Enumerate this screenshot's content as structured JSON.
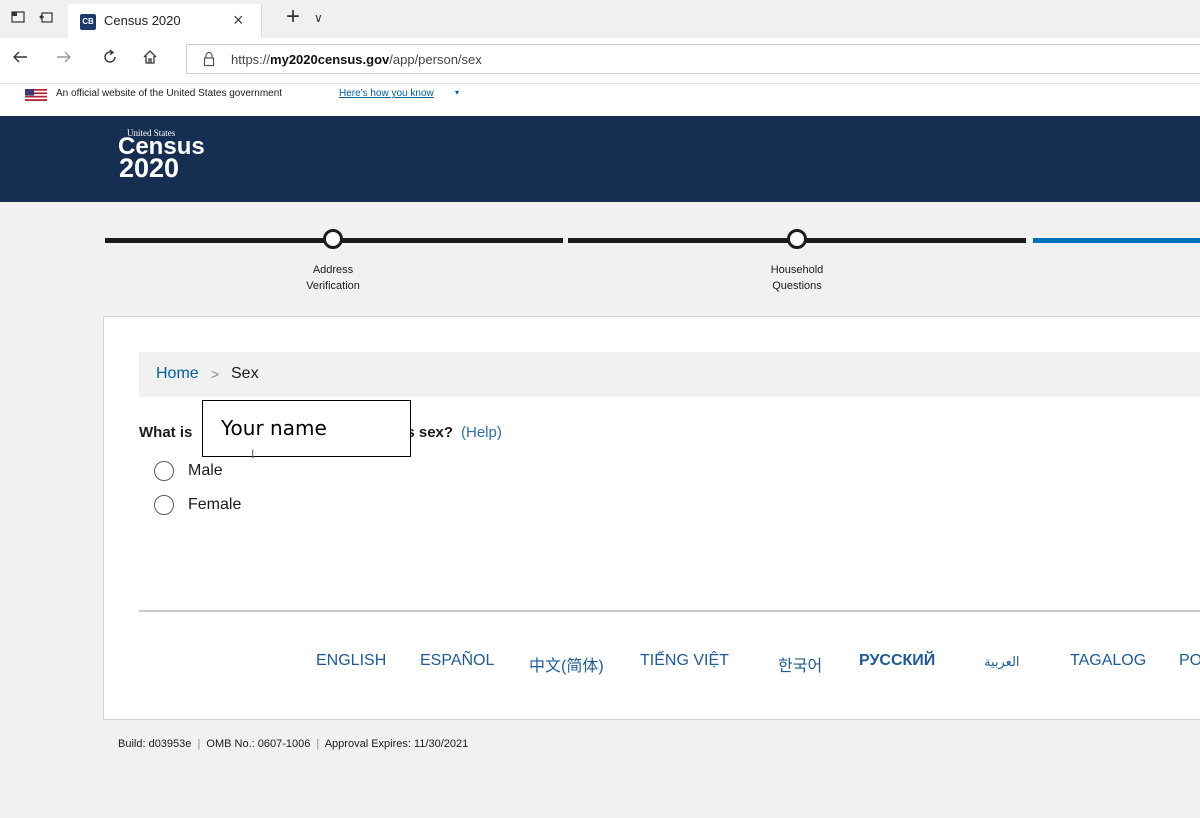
{
  "browser": {
    "tab_title": "Census 2020",
    "tab_favicon": "CB",
    "tab_close_glyph": "×",
    "new_tab_glyph": "+",
    "tab_dropdown_glyph": "∨",
    "url_prefix": "https://",
    "url_domain": "my2020census.gov",
    "url_path": "/app/person/sex",
    "icons": [
      "tab-manager-icon",
      "tab-aside-icon",
      "back-arrow-icon",
      "forward-arrow-icon",
      "refresh-icon",
      "home-icon",
      "lock-icon"
    ]
  },
  "gov_banner": {
    "text": "An official website of the United States government",
    "link": "Here's how you know",
    "caret": "▾"
  },
  "header": {
    "logo_small": "United States",
    "logo_word": "Census",
    "logo_year": "2020",
    "background": "#162e51"
  },
  "progress": {
    "steps": [
      {
        "label_line1": "Address",
        "label_line2": "Verification"
      },
      {
        "label_line1": "Household",
        "label_line2": "Questions"
      }
    ],
    "complete_color": "#1b1b1b",
    "active_color": "#0071bc"
  },
  "breadcrumb": {
    "home": "Home",
    "separator": ">",
    "current": "Sex"
  },
  "question": {
    "prefix": "What is",
    "suffix": "s sex?",
    "help": "(Help)",
    "overlay_name": "Your name",
    "cursor_glyph": "I"
  },
  "options": [
    {
      "label": "Male",
      "selected": false
    },
    {
      "label": "Female",
      "selected": false
    }
  ],
  "languages": [
    "ENGLISH",
    "ESPAÑOL",
    "中文(简体)",
    "TIẾNG VIỆT",
    "한국어",
    "РУССКИЙ",
    "العربية",
    "TAGALOG",
    "PO"
  ],
  "footer": {
    "build": "Build: d03953e",
    "omb": "OMB No.: 0607-1006",
    "approval": "Approval Expires: 11/30/2021",
    "separator": "|"
  }
}
